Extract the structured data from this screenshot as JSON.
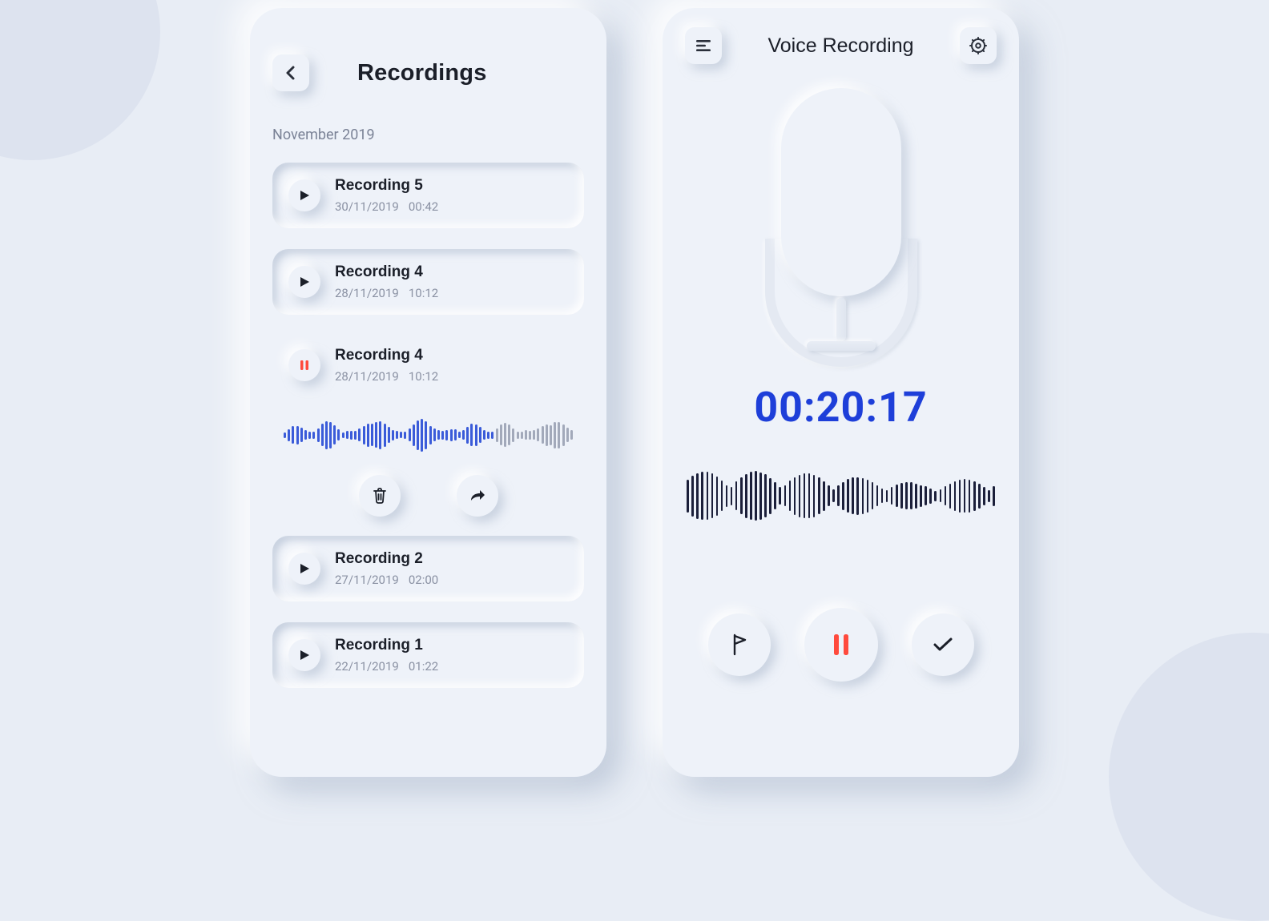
{
  "screen1": {
    "title": "Recordings",
    "section_label": "November 2019",
    "recordings": [
      {
        "title": "Recording 5",
        "date": "30/11/2019",
        "duration": "00:42",
        "state": "idle"
      },
      {
        "title": "Recording 4",
        "date": "28/11/2019",
        "duration": "10:12",
        "state": "idle"
      },
      {
        "title": "Recording 4",
        "date": "28/11/2019",
        "duration": "10:12",
        "state": "playing"
      },
      {
        "title": "Recording 2",
        "date": "27/11/2019",
        "duration": "02:00",
        "state": "idle"
      },
      {
        "title": "Recording 1",
        "date": "22/11/2019",
        "duration": "01:22",
        "state": "idle"
      }
    ],
    "waveform_progress_ratio": 0.72
  },
  "screen2": {
    "title": "Voice Recording",
    "timer": "00:20:17",
    "state": "recording-paused"
  },
  "colors": {
    "accent_blue": "#1e3fd9",
    "accent_red": "#ff4a3d",
    "wave_played": "#3a5bd9",
    "wave_unplayed": "#a2a9ba",
    "wave_dark": "#1b1f3a"
  },
  "icons": {
    "back": "chevron-left",
    "menu": "menu",
    "settings": "gear",
    "play": "play",
    "pause": "pause",
    "delete": "trash",
    "share": "share",
    "flag": "flag",
    "confirm": "check"
  }
}
